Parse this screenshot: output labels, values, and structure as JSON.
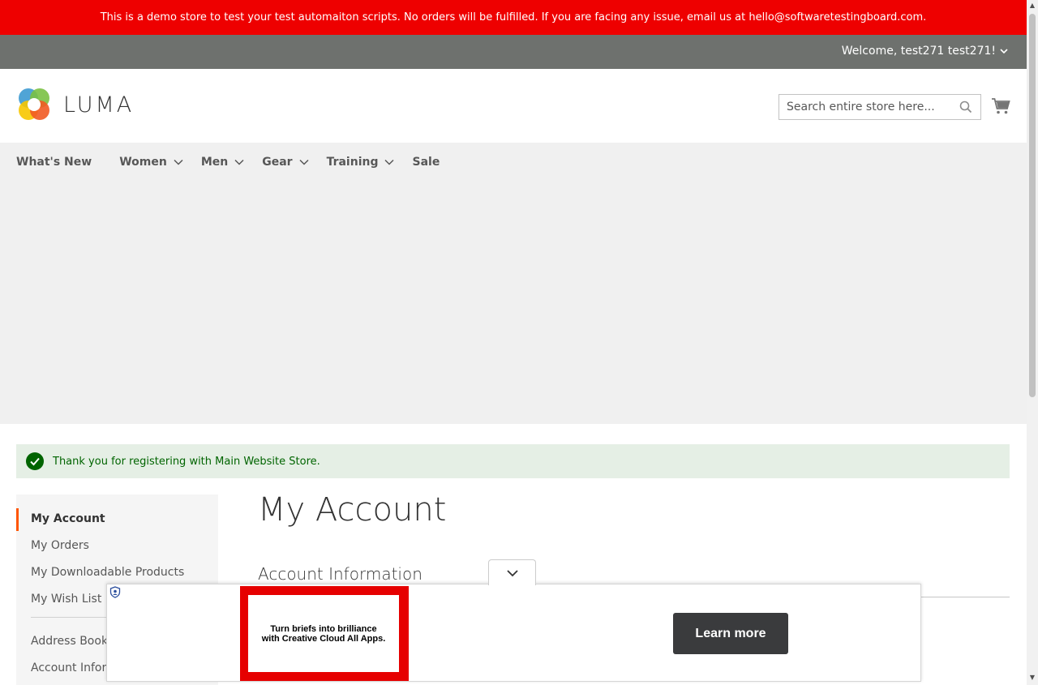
{
  "demo_notice": "This is a demo store to test your test automaiton scripts. No orders will be fulfilled. If you are facing any issue, email us at hello@softwaretestingboard.com.",
  "header": {
    "welcome": "Welcome, test271 test271!",
    "logo_text": "LUMA",
    "search_placeholder": "Search entire store here...",
    "search_value": ""
  },
  "nav": {
    "items": [
      {
        "label": "What's New",
        "has_submenu": false
      },
      {
        "label": "Women",
        "has_submenu": true
      },
      {
        "label": "Men",
        "has_submenu": true
      },
      {
        "label": "Gear",
        "has_submenu": true
      },
      {
        "label": "Training",
        "has_submenu": true
      },
      {
        "label": "Sale",
        "has_submenu": false
      }
    ]
  },
  "message": {
    "text": "Thank you for registering with Main Website Store.",
    "type": "success"
  },
  "sidebar": {
    "items": [
      {
        "label": "My Account",
        "current": true
      },
      {
        "label": "My Orders"
      },
      {
        "label": "My Downloadable Products"
      },
      {
        "label": "My Wish List"
      },
      {
        "label": "Address Book"
      },
      {
        "label": "Account Information"
      }
    ]
  },
  "main": {
    "page_title": "My Account",
    "section_title": "Account Information"
  },
  "ad": {
    "headline_line1": "Turn briefs into brilliance",
    "headline_line2": "with Creative Cloud All Apps.",
    "cta": "Learn more"
  },
  "colors": {
    "demo_banner": "#ee0000",
    "header_bar": "#6e716e",
    "nav_bg": "#f0f0f0",
    "success_bg": "#e5efe5",
    "success_text": "#006400",
    "accent": "#ff5501",
    "ad_cta": "#3a3b3d"
  },
  "icons": [
    "chevron-down-icon",
    "search-icon",
    "cart-icon",
    "check-icon",
    "shield-icon",
    "luma-logo-icon"
  ]
}
